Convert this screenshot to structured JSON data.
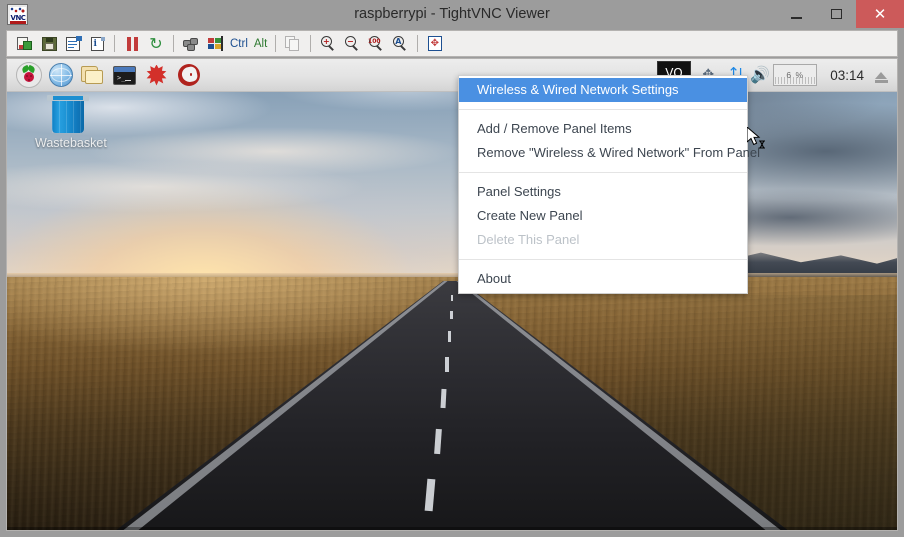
{
  "window": {
    "title": "raspberrypi - TightVNC Viewer",
    "icon": "vnc-logo-icon",
    "vnc_mark": "VNC",
    "buttons": {
      "minimize": "–",
      "maximize": "▢",
      "close": "✕"
    }
  },
  "vnc_toolbar": {
    "items": [
      {
        "name": "new-connection-icon",
        "tooltip": "New connection"
      },
      {
        "name": "save-session-icon",
        "tooltip": "Save session"
      },
      {
        "name": "connection-options-icon",
        "tooltip": "Connection options"
      },
      {
        "name": "connection-info-icon",
        "tooltip": "Connection info"
      },
      {
        "name": "pause-updates-icon",
        "tooltip": "Pause updates"
      },
      {
        "name": "refresh-screen-icon",
        "tooltip": "Refresh screen"
      },
      {
        "name": "send-keys-icon",
        "tooltip": "Send keys"
      },
      {
        "name": "ctrl-alt-del-icon",
        "tooltip": "Ctrl-Alt-Del"
      },
      {
        "name": "ctrl-key-label",
        "label": "Ctrl"
      },
      {
        "name": "alt-key-label",
        "label": "Alt"
      },
      {
        "name": "transfer-files-icon",
        "tooltip": "Transfer files"
      },
      {
        "name": "zoom-in-icon",
        "label": "+"
      },
      {
        "name": "zoom-out-icon",
        "label": "−"
      },
      {
        "name": "zoom-100-icon",
        "label": "100"
      },
      {
        "name": "zoom-auto-icon",
        "label": "A"
      },
      {
        "name": "fullscreen-icon",
        "tooltip": "Full screen"
      }
    ],
    "ctrl_label": "Ctrl",
    "alt_label": "Alt",
    "zoom100_label": "100",
    "zoomauto_label": "A",
    "zoomin_label": "+",
    "zoomout_label": "−",
    "fullscreen_glyph": "✥"
  },
  "desktop": {
    "wallpaper_name": "road-sunset-wallpaper",
    "icons": [
      {
        "name": "wastebasket-icon",
        "label": "Wastebasket"
      }
    ]
  },
  "panel": {
    "launchers": [
      {
        "name": "raspberry-menu-icon",
        "label": "Menu"
      },
      {
        "name": "web-browser-icon",
        "label": "Web Browser"
      },
      {
        "name": "file-manager-icon",
        "label": "File Manager"
      },
      {
        "name": "terminal-icon",
        "label": "Terminal"
      },
      {
        "name": "mathematica-icon",
        "label": "Mathematica"
      },
      {
        "name": "wolfram-icon",
        "label": "Wolfram"
      }
    ],
    "tray": {
      "hidden_item_text": "VO",
      "bluetooth_icon": "bluetooth-icon",
      "network_icon": "wireless-wired-network-icon",
      "volume_icon": "volume-icon",
      "cpu_label": "6 %",
      "clock": "03:14",
      "eject_icon": "eject-icon"
    }
  },
  "context_menu": {
    "name": "panel-context-menu",
    "groups": [
      {
        "items": [
          {
            "label": "Wireless & Wired Network Settings",
            "state": "selected"
          }
        ]
      },
      {
        "items": [
          {
            "label": "Add / Remove Panel Items",
            "state": "normal"
          },
          {
            "label": "Remove \"Wireless & Wired Network\" From Panel",
            "state": "normal"
          }
        ]
      },
      {
        "items": [
          {
            "label": "Panel Settings",
            "state": "normal"
          },
          {
            "label": "Create New Panel",
            "state": "normal"
          },
          {
            "label": "Delete This Panel",
            "state": "disabled"
          }
        ]
      },
      {
        "items": [
          {
            "label": "About",
            "state": "normal"
          }
        ]
      }
    ]
  },
  "colors": {
    "menu_highlight": "#4a90e2",
    "titlebar_bg": "#9c9c9c",
    "close_button": "#cc5a5a",
    "toolbar_bg": "#f0efee",
    "panel_bg": "#e8e8e8",
    "menu_text": "#3d4650",
    "menu_disabled": "#bcc2c8"
  }
}
